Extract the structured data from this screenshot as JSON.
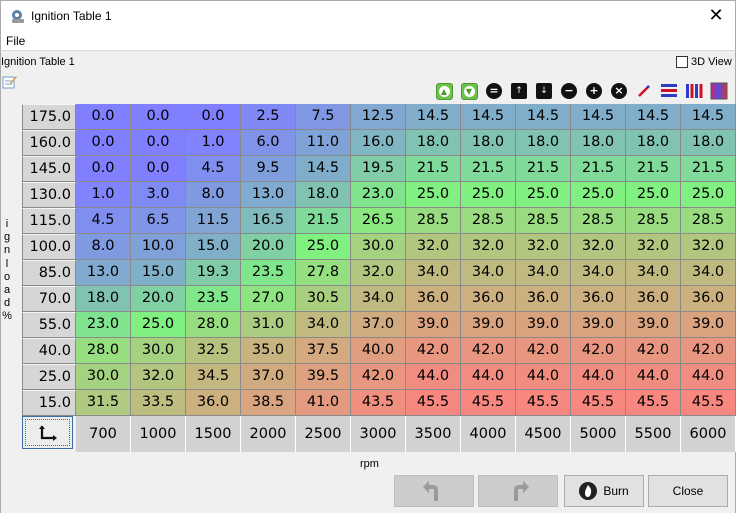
{
  "window": {
    "title": "Ignition Table 1",
    "icon": "gear-wrench-icon",
    "close_glyph": "✕"
  },
  "menu": {
    "file": "File"
  },
  "panel": {
    "table_name": "Ignition Table 1",
    "view3d_label": "3D View",
    "view3d_checked": false
  },
  "toolbar": {
    "buttons": [
      {
        "name": "increment-green-icon",
        "glyph": "▲"
      },
      {
        "name": "decrement-green-icon",
        "glyph": "▼"
      },
      {
        "name": "set-equal-icon",
        "glyph": "="
      },
      {
        "name": "shift-up-icon",
        "glyph": "↑"
      },
      {
        "name": "shift-down-icon",
        "glyph": "↓"
      },
      {
        "name": "subtract-icon",
        "glyph": "−"
      },
      {
        "name": "add-icon",
        "glyph": "+"
      },
      {
        "name": "multiply-icon",
        "glyph": "×"
      },
      {
        "name": "interpolate-icon",
        "glyph": "/"
      },
      {
        "name": "smooth-rows-icon",
        "glyph": ""
      },
      {
        "name": "smooth-columns-icon",
        "glyph": ""
      },
      {
        "name": "color-scale-icon",
        "glyph": ""
      }
    ]
  },
  "table": {
    "y_axis_label": "ignload%",
    "x_axis_label": "rpm",
    "rows": [
      "175.0",
      "160.0",
      "145.0",
      "130.0",
      "115.0",
      "100.0",
      "85.0",
      "70.0",
      "55.0",
      "40.0",
      "25.0",
      "15.0"
    ],
    "columns": [
      "700",
      "1000",
      "1500",
      "2000",
      "2500",
      "3000",
      "3500",
      "4000",
      "4500",
      "5000",
      "5500",
      "6000"
    ],
    "cells": [
      [
        "0.0",
        "0.0",
        "0.0",
        "2.5",
        "7.5",
        "12.5",
        "14.5",
        "14.5",
        "14.5",
        "14.5",
        "14.5",
        "14.5"
      ],
      [
        "0.0",
        "0.0",
        "1.0",
        "6.0",
        "11.0",
        "16.0",
        "18.0",
        "18.0",
        "18.0",
        "18.0",
        "18.0",
        "18.0"
      ],
      [
        "0.0",
        "0.0",
        "4.5",
        "9.5",
        "14.5",
        "19.5",
        "21.5",
        "21.5",
        "21.5",
        "21.5",
        "21.5",
        "21.5"
      ],
      [
        "1.0",
        "3.0",
        "8.0",
        "13.0",
        "18.0",
        "23.0",
        "25.0",
        "25.0",
        "25.0",
        "25.0",
        "25.0",
        "25.0"
      ],
      [
        "4.5",
        "6.5",
        "11.5",
        "16.5",
        "21.5",
        "26.5",
        "28.5",
        "28.5",
        "28.5",
        "28.5",
        "28.5",
        "28.5"
      ],
      [
        "8.0",
        "10.0",
        "15.0",
        "20.0",
        "25.0",
        "30.0",
        "32.0",
        "32.0",
        "32.0",
        "32.0",
        "32.0",
        "32.0"
      ],
      [
        "13.0",
        "15.0",
        "19.3",
        "23.5",
        "27.8",
        "32.0",
        "34.0",
        "34.0",
        "34.0",
        "34.0",
        "34.0",
        "34.0"
      ],
      [
        "18.0",
        "20.0",
        "23.5",
        "27.0",
        "30.5",
        "34.0",
        "36.0",
        "36.0",
        "36.0",
        "36.0",
        "36.0",
        "36.0"
      ],
      [
        "23.0",
        "25.0",
        "28.0",
        "31.0",
        "34.0",
        "37.0",
        "39.0",
        "39.0",
        "39.0",
        "39.0",
        "39.0",
        "39.0"
      ],
      [
        "28.0",
        "30.0",
        "32.5",
        "35.0",
        "37.5",
        "40.0",
        "42.0",
        "42.0",
        "42.0",
        "42.0",
        "42.0",
        "42.0"
      ],
      [
        "30.0",
        "32.0",
        "34.5",
        "37.0",
        "39.5",
        "42.0",
        "44.0",
        "44.0",
        "44.0",
        "44.0",
        "44.0",
        "44.0"
      ],
      [
        "31.5",
        "33.5",
        "36.0",
        "38.5",
        "41.0",
        "43.5",
        "45.5",
        "45.5",
        "45.5",
        "45.5",
        "45.5",
        "45.5"
      ]
    ],
    "corner_icon": "swap-axes-icon"
  },
  "buttons": {
    "undo_icon": "undo-icon",
    "redo_icon": "redo-icon",
    "burn": "Burn",
    "close": "Close"
  }
}
